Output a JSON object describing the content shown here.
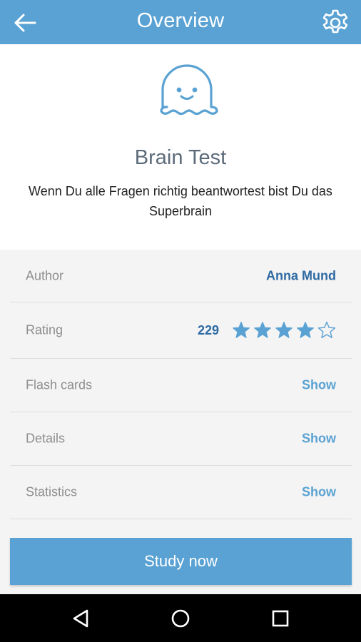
{
  "header": {
    "title": "Overview",
    "back_icon": "arrow-left-icon",
    "settings_icon": "gear-icon"
  },
  "deck": {
    "icon": "ghost-icon",
    "title": "Brain Test",
    "description": "Wenn Du alle Fragen richtig beantwortest bist Du das Superbrain"
  },
  "info": {
    "author": {
      "label": "Author",
      "value": "Anna Mund"
    },
    "rating": {
      "label": "Rating",
      "count": "229",
      "stars_filled": 4,
      "stars_total": 5
    },
    "flashcards": {
      "label": "Flash cards",
      "action": "Show"
    },
    "details": {
      "label": "Details",
      "action": "Show"
    },
    "statistics": {
      "label": "Statistics",
      "action": "Show"
    }
  },
  "study_button": "Study now",
  "system_nav": {
    "back": "triangle-back-icon",
    "home": "circle-home-icon",
    "recents": "square-recents-icon"
  },
  "colors": {
    "accent": "#5aa2d3",
    "value_text": "#2e6aa3",
    "label_text": "#8e8e8e",
    "background": "#f4f4f4"
  }
}
